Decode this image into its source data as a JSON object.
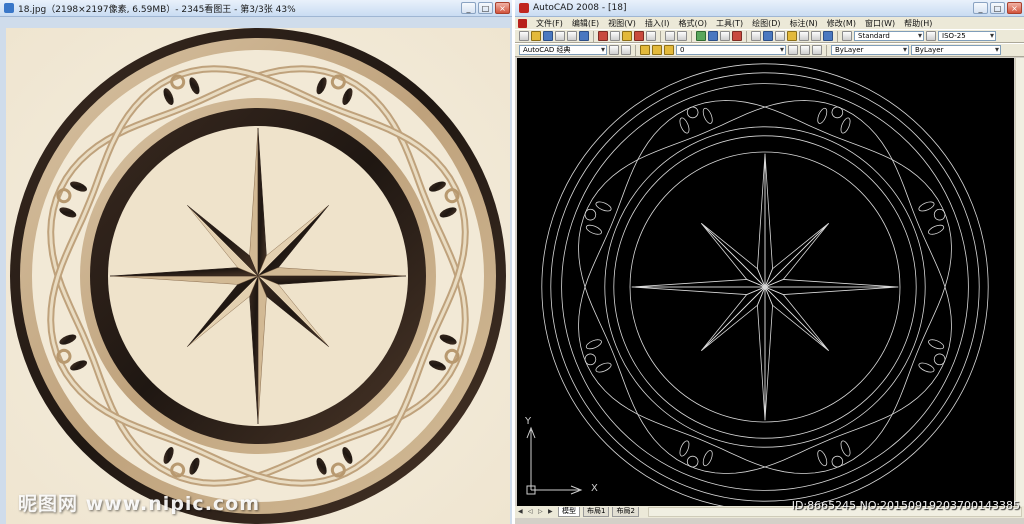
{
  "viewer": {
    "title": "18.jpg（2198×2197像素, 6.59MB）- 2345看图王 - 第3/3张 43%",
    "watermark": "昵图网 www.nipic.com"
  },
  "cad": {
    "title": "AutoCAD 2008 - [18]",
    "menus": [
      "文件(F)",
      "编辑(E)",
      "视图(V)",
      "插入(I)",
      "格式(O)",
      "工具(T)",
      "绘图(D)",
      "标注(N)",
      "修改(M)",
      "窗口(W)",
      "帮助(H)"
    ],
    "workspace": "AutoCAD 经典",
    "text_style": "Standard",
    "dim_style": "ISO-25",
    "layer": "0",
    "color": "ByLayer",
    "linetype": "ByLayer",
    "tabs": [
      "模型",
      "布局1",
      "布局2"
    ],
    "ucs_x": "X",
    "ucs_y": "Y"
  },
  "id_text": "ID:8665245 NO:20150919203700143385",
  "colors": {
    "marble_light": "#f4ecdb",
    "marble_tan": "#cdb28d",
    "marble_dark": "#2a1f19",
    "cad_bg": "#000000",
    "cad_line": "#d9d9d9"
  }
}
